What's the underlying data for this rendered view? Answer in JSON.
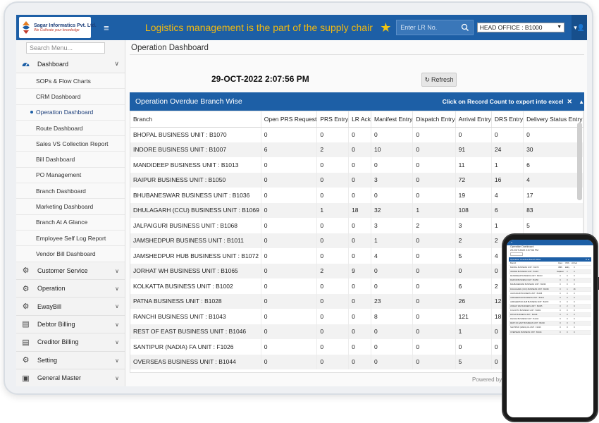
{
  "header": {
    "logo_name": "Sagar Informatics Pvt. Ltd.",
    "logo_tagline": "We Cultivate your knowledge",
    "tagline": "Logistics management is the part of the supply chair",
    "lr_search_placeholder": "Enter LR No.",
    "office_selected": "HEAD OFFICE : B1000",
    "colors": {
      "bar": "#1d5fa6",
      "tagline": "#f2b90f",
      "star": "#f2c511"
    }
  },
  "sidebar": {
    "search_placeholder": "Search Menu...",
    "dashboard": "Dashboard",
    "dashboard_items": [
      "SOPs & Flow Charts",
      "CRM Dashboard",
      "Operation Dashboard",
      "Route Dashboard",
      "Sales VS Collection Report",
      "Bill Dashboard",
      "PO Management",
      "Branch Dashboard",
      "Marketing Dashboard",
      "Branch At A Glance",
      "Employee Self Log Report",
      "Vendor Bill Dashboard"
    ],
    "groups": [
      {
        "label": "Customer Service",
        "icon": "gear-icon"
      },
      {
        "label": "Operation",
        "icon": "gear-icon"
      },
      {
        "label": "EwayBill",
        "icon": "gear-icon"
      },
      {
        "label": "Debtor Billing",
        "icon": "document-icon"
      },
      {
        "label": "Creditor Billing",
        "icon": "document-icon"
      },
      {
        "label": "Setting",
        "icon": "gear-icon"
      },
      {
        "label": "General Master",
        "icon": "briefcase-icon"
      }
    ]
  },
  "main": {
    "page_title": "Operation Dashboard",
    "datetime": "29-OCT-2022 2:07:56 PM",
    "refresh_label": "Refresh",
    "panel_title": "Operation Overdue Branch Wise",
    "panel_note": "Click on Record Count to export into excel",
    "columns": [
      "Branch",
      "Open PRS Request",
      "PRS Entry",
      "LR Ack",
      "Manifest Entry",
      "Dispatch Entry",
      "Arrival Entry",
      "DRS Entry",
      "Delivery Status Entry"
    ],
    "rows": [
      [
        "BHOPAL BUSINESS UNIT : B1070",
        "0",
        "0",
        "0",
        "0",
        "0",
        "0",
        "0",
        "0"
      ],
      [
        "INDORE BUSINESS UNIT : B1007",
        "6",
        "2",
        "0",
        "10",
        "0",
        "91",
        "24",
        "30"
      ],
      [
        "MANDIDEEP BUSINESS UNIT : B1013",
        "0",
        "0",
        "0",
        "0",
        "0",
        "11",
        "1",
        "6"
      ],
      [
        "RAIPUR BUSINESS UNIT : B1050",
        "0",
        "0",
        "0",
        "3",
        "0",
        "72",
        "16",
        "4"
      ],
      [
        "BHUBANESWAR BUSINESS UNIT : B1036",
        "0",
        "0",
        "0",
        "0",
        "0",
        "19",
        "4",
        "17"
      ],
      [
        "DHULAGARH (CCU) BUSINESS UNIT : B1069",
        "0",
        "1",
        "18",
        "32",
        "1",
        "108",
        "6",
        "83"
      ],
      [
        "JALPAIGURI BUSINESS UNIT : B1068",
        "0",
        "0",
        "0",
        "3",
        "2",
        "3",
        "1",
        "5"
      ],
      [
        "JAMSHEDPUR BUSINESS UNIT : B1011",
        "0",
        "0",
        "0",
        "1",
        "0",
        "2",
        "2",
        "0"
      ],
      [
        "JAMSHEDPUR HUB BUSINESS UNIT : B1072",
        "0",
        "0",
        "0",
        "4",
        "0",
        "5",
        "4",
        ""
      ],
      [
        "JORHAT WH BUSINESS UNIT : B1065",
        "0",
        "2",
        "9",
        "0",
        "0",
        "0",
        "0",
        ""
      ],
      [
        "KOLKATTA BUSINESS UNIT : B1002",
        "0",
        "0",
        "0",
        "0",
        "0",
        "6",
        "2",
        ""
      ],
      [
        "PATNA BUSINESS UNIT : B1028",
        "0",
        "0",
        "0",
        "23",
        "0",
        "26",
        "12",
        ""
      ],
      [
        "RANCHI BUSINESS UNIT : B1043",
        "0",
        "0",
        "0",
        "8",
        "0",
        "121",
        "18",
        ""
      ],
      [
        "REST OF EAST BUSINESS UNIT : B1046",
        "0",
        "0",
        "0",
        "0",
        "0",
        "1",
        "0",
        ""
      ],
      [
        "SANTIPUR (NADIA) FA UNIT : F1026",
        "0",
        "0",
        "0",
        "0",
        "0",
        "0",
        "0",
        ""
      ],
      [
        "OVERSEAS BUSINESS UNIT : B1044",
        "0",
        "0",
        "0",
        "0",
        "0",
        "5",
        "0",
        ""
      ]
    ],
    "powered_by": "Powered by: Sagar I"
  }
}
